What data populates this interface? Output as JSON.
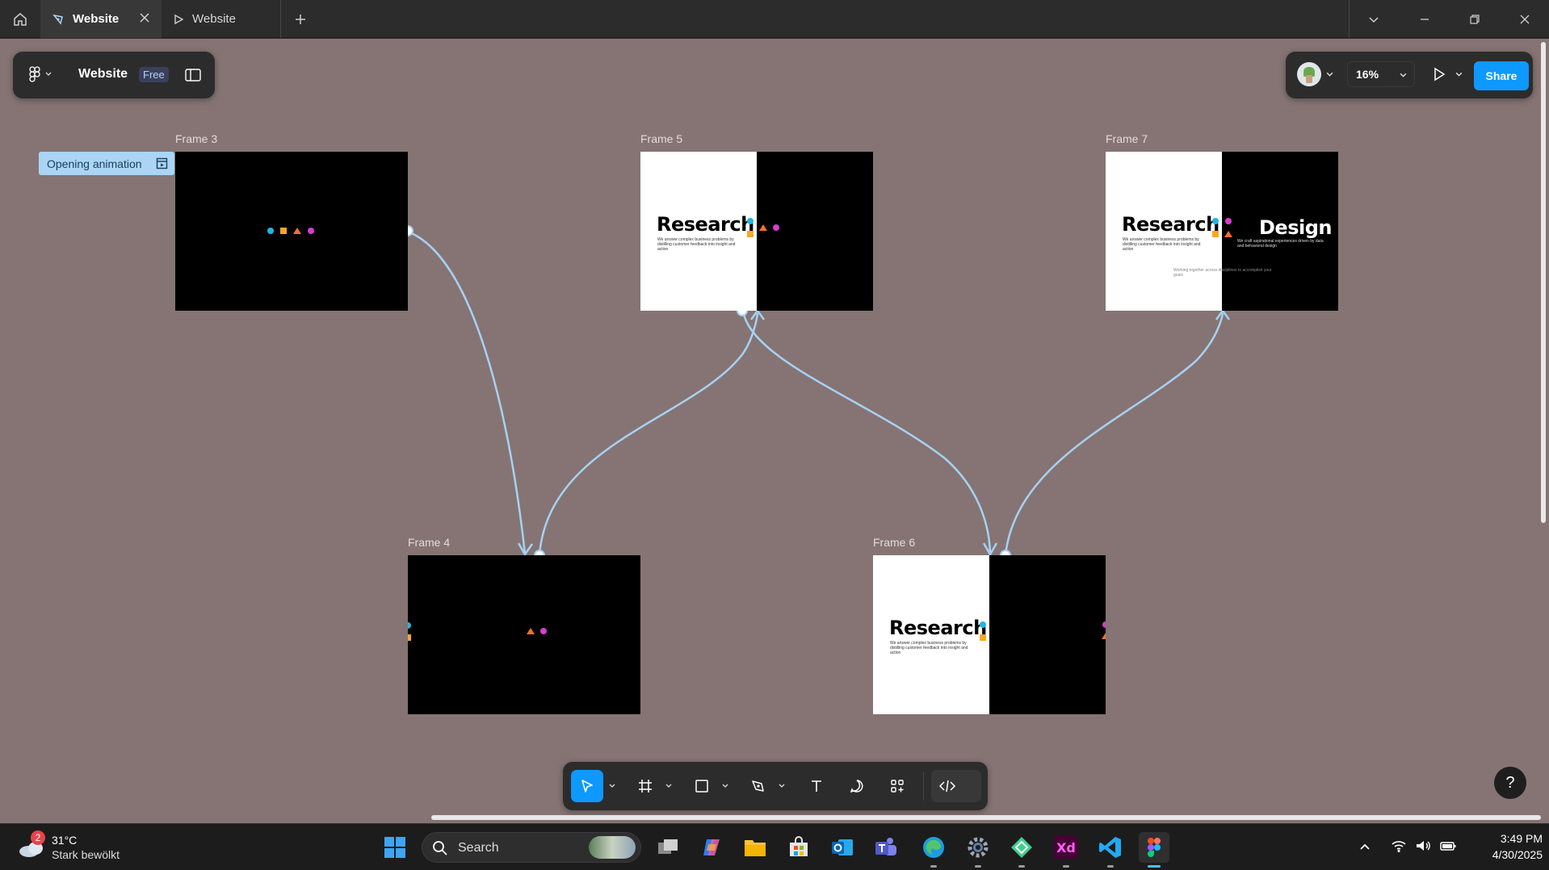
{
  "tabs": [
    {
      "label": "Website",
      "active": true
    },
    {
      "label": "Website",
      "active": false
    }
  ],
  "file": {
    "name": "Website",
    "plan": "Free"
  },
  "zoom": "16%",
  "share_label": "Share",
  "frames": {
    "f3": {
      "label": "Frame 3"
    },
    "f4": {
      "label": "Frame 4"
    },
    "f5": {
      "label": "Frame 5",
      "word": "Research",
      "body": "We answer complex business problems by distilling customer feedback into insight and action"
    },
    "f6": {
      "label": "Frame 6",
      "word": "Research",
      "body": "We answer complex business problems by distilling customer feedback into insight and action"
    },
    "f7": {
      "label": "Frame 7",
      "word": "Research",
      "word2": "Design",
      "body": "We answer complex business problems by distilling customer feedback into insight and action",
      "body2": "We craft aspirational experiences driven by data and behavioral design",
      "footer": "Working together across disciplines to accomplish your goals"
    }
  },
  "flow_badge": "Opening animation",
  "shape_colors": {
    "circle_blue": "#1fb6e3",
    "square_orange": "#f9a825",
    "triangle_orange": "#f26f31",
    "circle_pink": "#d63ccf"
  },
  "canvas_color": "#857473",
  "accent": "#0d99ff",
  "taskbar": {
    "weather_temp": "31°C",
    "weather_desc": "Stark bewölkt",
    "weather_badge": "2",
    "search_placeholder": "Search",
    "time": "3:49 PM",
    "date": "4/30/2025"
  }
}
